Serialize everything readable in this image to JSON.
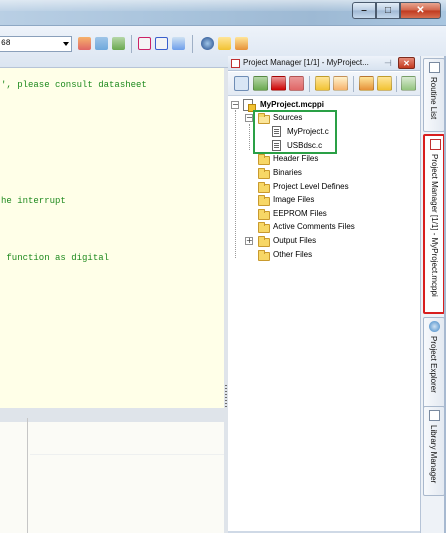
{
  "window": {
    "controls": {
      "minimize": "–",
      "maximize": "□",
      "close": "✕"
    }
  },
  "toolbar": {
    "combo_value": "68",
    "icons": [
      "build-icon",
      "build-all-icon",
      "program-icon",
      "font-icon",
      "italic-icon",
      "display-icon",
      "help-icon",
      "tools-icon",
      "options-icon"
    ]
  },
  "editor": {
    "lines": [
      "', please consult datasheet",
      "he interrupt",
      " function as digital"
    ]
  },
  "project_manager": {
    "title": "Project Manager [1/1] - MyProject...",
    "pin": "⊣",
    "close": "✕",
    "tree": {
      "root": "MyProject.mcppi",
      "sources": {
        "label": "Sources",
        "files": [
          "MyProject.c",
          "USBdsc.c"
        ]
      },
      "folders": [
        "Header Files",
        "Binaries",
        "Project Level Defines",
        "Image Files",
        "EEPROM Files",
        "Active Comments Files",
        "Output Files",
        "Other Files"
      ],
      "expanders": {
        "root": "−",
        "sources": "−",
        "output": "+"
      }
    },
    "highlight_color": "#2aa046"
  },
  "side_tabs": [
    {
      "label": "Routine List",
      "active": false
    },
    {
      "label": "Project Manager [1/1] - MyProject.mcppi",
      "active": true
    },
    {
      "label": "Project Explorer",
      "active": false
    },
    {
      "label": "Library Manager",
      "active": false
    }
  ],
  "colors": {
    "editor_bg": "#ffffe8",
    "code_text": "#1e8a1e",
    "active_tab_border": "#d81e1e",
    "close_button": "#c0391f"
  }
}
